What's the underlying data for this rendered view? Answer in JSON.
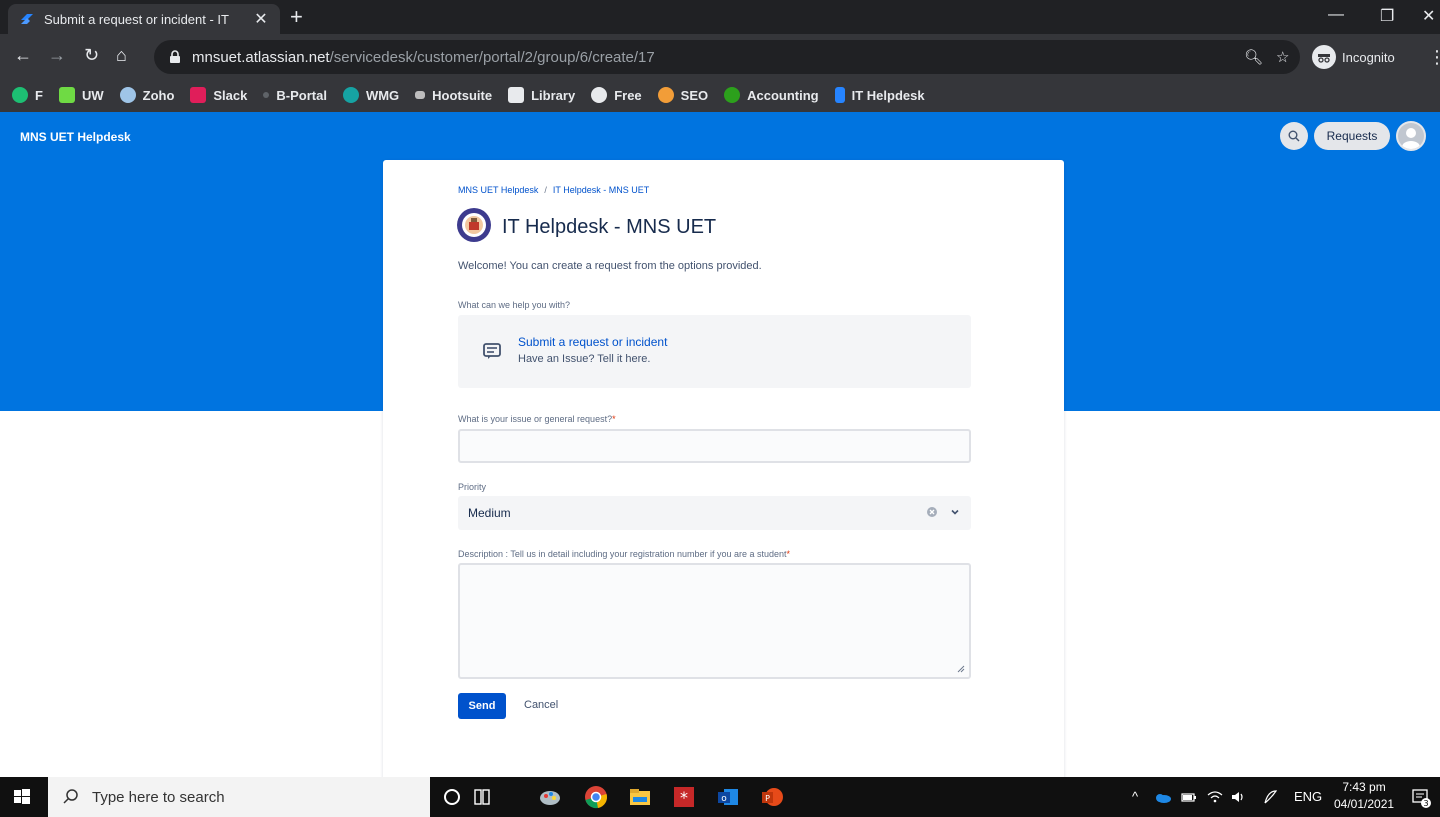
{
  "browser": {
    "tab_title": "Submit a request or incident - IT",
    "tab_close": "✕",
    "new_tab": "+",
    "url_host": "mnsuet.atlassian.net",
    "url_path": "/servicedesk/customer/portal/2/group/6/create/17",
    "incognito_label": "Incognito",
    "bookmarks": [
      {
        "label": "F",
        "color": "#1dbf73"
      },
      {
        "label": "UW",
        "color": "#6fda44"
      },
      {
        "label": "Zoho",
        "color": "#9fc5e8"
      },
      {
        "label": "Slack",
        "color": "#e01e5a"
      },
      {
        "label": "B-Portal",
        "color": "#5f6368"
      },
      {
        "label": "WMG",
        "color": "#16a3a3"
      },
      {
        "label": "Hootsuite",
        "color": "#bdbdbd"
      },
      {
        "label": "Library",
        "color": "#e8eaed"
      },
      {
        "label": "Free",
        "color": "#e8eaed"
      },
      {
        "label": "SEO",
        "color": "#f29d38"
      },
      {
        "label": "Accounting",
        "color": "#2ca01c"
      },
      {
        "label": "IT Helpdesk",
        "color": "#2684ff"
      }
    ]
  },
  "app": {
    "brand": "MNS UET Helpdesk",
    "requests_label": "Requests"
  },
  "card": {
    "breadcrumb_1": "MNS UET Helpdesk",
    "breadcrumb_sep": "/",
    "breadcrumb_2": "IT Helpdesk - MNS UET",
    "title": "IT Helpdesk - MNS UET",
    "welcome": "Welcome! You can create a request from the options provided.",
    "help_label": "What can we help you with?",
    "request_type": {
      "name": "Submit a request or incident",
      "description": "Have an Issue? Tell it here."
    },
    "summary_label": "What is your issue or general request?",
    "summary_value": "",
    "priority_label": "Priority",
    "priority_value": "Medium",
    "description_label": "Description : Tell us in detail including your registration number if you are a student",
    "description_value": "",
    "required_mark": "*",
    "send_label": "Send",
    "cancel_label": "Cancel"
  },
  "taskbar": {
    "search_placeholder": "Type here to search",
    "language": "ENG",
    "time": "7:43 pm",
    "date": "04/01/2021",
    "notification_count": "3"
  },
  "colors": {
    "hero_blue": "#0074e0",
    "link_blue": "#0052cc",
    "primary_button": "#0052cc",
    "required_red": "#de350b"
  }
}
